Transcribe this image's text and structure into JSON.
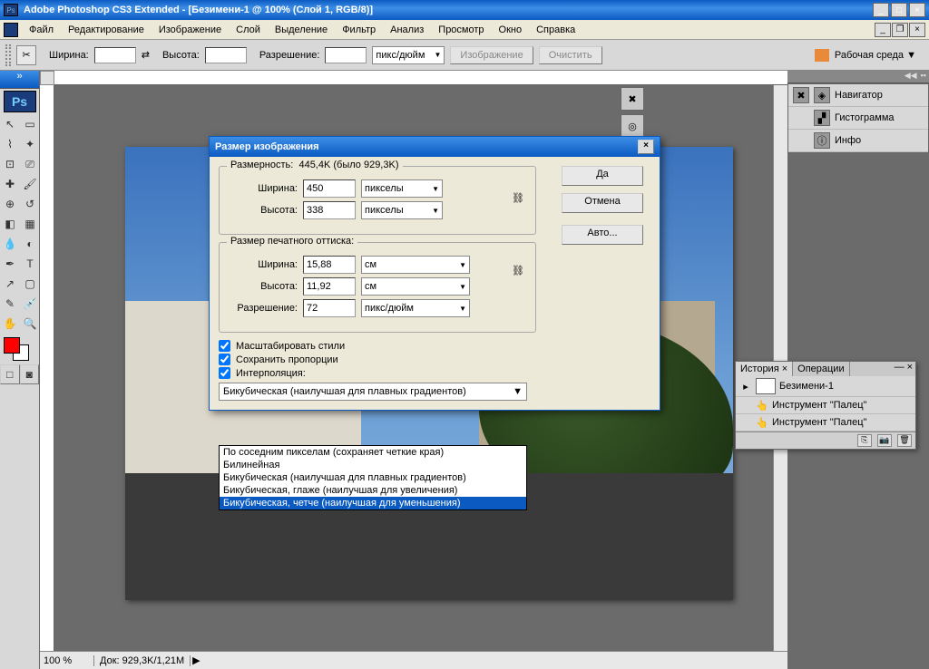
{
  "app": {
    "title": "Adobe Photoshop CS3 Extended - [Безимени-1 @ 100% (Слой 1, RGB/8)]"
  },
  "menu": {
    "items": [
      "Файл",
      "Редактирование",
      "Изображение",
      "Слой",
      "Выделение",
      "Фильтр",
      "Анализ",
      "Просмотр",
      "Окно",
      "Справка"
    ]
  },
  "options": {
    "width_label": "Ширина:",
    "height_label": "Высота:",
    "resolution_label": "Разрешение:",
    "unit": "пикс/дюйм",
    "btn_image": "Изображение",
    "btn_clear": "Очистить",
    "workspace": "Рабочая среда ▼"
  },
  "status": {
    "zoom": "100 %",
    "doc": "Док: 929,3K/1,21M"
  },
  "panels": {
    "navigator": "Навигатор",
    "histogram": "Гистограмма",
    "info": "Инфо"
  },
  "history": {
    "tab1": "История ×",
    "tab2": "Операции",
    "doc": "Безимени-1",
    "item1": "Инструмент \"Палец\"",
    "item2": "Инструмент \"Палец\""
  },
  "dialog": {
    "title": "Размер изображения",
    "dim_label": "Размерность:",
    "dim_value": "445,4K (было 929,3K)",
    "px_width_label": "Ширина:",
    "px_width": "450",
    "px_height_label": "Высота:",
    "px_height": "338",
    "px_unit": "пикселы",
    "print_label": "Размер печатного оттиска:",
    "pr_width_label": "Ширина:",
    "pr_width": "15,88",
    "pr_height_label": "Высота:",
    "pr_height": "11,92",
    "pr_unit": "см",
    "res_label": "Разрешение:",
    "res_value": "72",
    "res_unit": "пикс/дюйм",
    "chk_scale": "Масштабировать стили",
    "chk_prop": "Сохранить пропорции",
    "chk_interp": "Интерполяция:",
    "interp_value": "Бикубическая (наилучшая для плавных градиентов)",
    "btn_ok": "Да",
    "btn_cancel": "Отмена",
    "btn_auto": "Авто...",
    "dropdown": [
      "По соседним пикселам (сохраняет четкие края)",
      "Билинейная",
      "Бикубическая (наилучшая для плавных градиентов)",
      "Бикубическая, глаже (наилучшая для увеличения)",
      "Бикубическая, четче (наилучшая для уменьшения)"
    ]
  }
}
